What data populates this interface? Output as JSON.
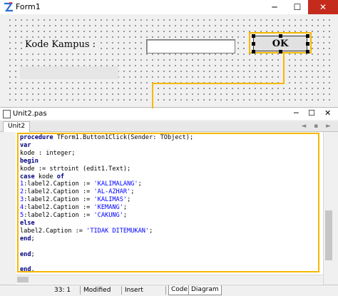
{
  "form": {
    "title": "Form1",
    "controls": {
      "minimize": "─",
      "maximize": "☐",
      "close": "✕"
    },
    "kode_label": "Kode Kampus :",
    "ok_label": "OK"
  },
  "editor": {
    "title": "Unit2.pas",
    "tab": "Unit2",
    "nav": "◄ ▪ ►",
    "code": [
      [
        [
          "kw",
          "procedure"
        ],
        [
          "t",
          " TForm1.Button1Click(Sender: TObject);"
        ]
      ],
      [
        [
          "kw",
          "var"
        ]
      ],
      [
        [
          "t",
          "kode : integer;"
        ]
      ],
      [
        [
          "kw",
          "begin"
        ]
      ],
      [
        [
          "t",
          "kode := strtoint (edit1.Text);"
        ]
      ],
      [
        [
          "kw",
          "case"
        ],
        [
          "t",
          " kode "
        ],
        [
          "kw",
          "of"
        ]
      ],
      [
        [
          "num",
          "1"
        ],
        [
          "t",
          ":label2.Caption := "
        ],
        [
          "str",
          "'KALIMALANG'"
        ],
        [
          "t",
          ";"
        ]
      ],
      [
        [
          "num",
          "2"
        ],
        [
          "t",
          ":label2.Caption := "
        ],
        [
          "str",
          "'AL-AZHAR'"
        ],
        [
          "t",
          ";"
        ]
      ],
      [
        [
          "num",
          "3"
        ],
        [
          "t",
          ":label2.Caption := "
        ],
        [
          "str",
          "'KALIMAS'"
        ],
        [
          "t",
          ";"
        ]
      ],
      [
        [
          "num",
          "4"
        ],
        [
          "t",
          ":label2.Caption := "
        ],
        [
          "str",
          "'KEMANG'"
        ],
        [
          "t",
          ";"
        ]
      ],
      [
        [
          "num",
          "5"
        ],
        [
          "t",
          ":label2.Caption := "
        ],
        [
          "str",
          "'CAKUNG'"
        ],
        [
          "t",
          ";"
        ]
      ],
      [
        [
          "kw",
          "else"
        ]
      ],
      [
        [
          "t",
          "label2.Caption := "
        ],
        [
          "str",
          "'TIDAK DITEMUKAN'"
        ],
        [
          "t",
          ";"
        ]
      ],
      [
        [
          "kw",
          "end"
        ],
        [
          "t",
          ";"
        ]
      ],
      [
        [
          "t",
          ""
        ]
      ],
      [
        [
          "kw",
          "end"
        ],
        [
          "t",
          ";"
        ]
      ],
      [
        [
          "t",
          ""
        ]
      ],
      [
        [
          "kw",
          "end"
        ],
        [
          "t",
          "."
        ]
      ]
    ]
  },
  "status": {
    "position": "33:  1",
    "state": "Modified",
    "mode": "Insert",
    "tab_code": "Code",
    "tab_diagram": "Diagram"
  },
  "colors": {
    "highlight": "#f5b800",
    "keyword": "#000080",
    "literal": "#0000ff"
  }
}
